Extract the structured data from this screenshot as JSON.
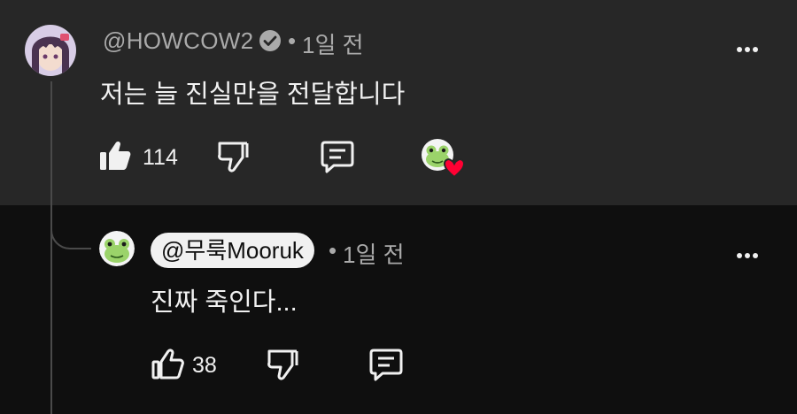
{
  "comment": {
    "author": "@HOWCOW2",
    "verified_icon": "check-circle-icon",
    "separator": "•",
    "time": "1일 전",
    "text": "저는 늘 진실만을 전달합니다",
    "like_count": "114",
    "creator_heart": "creator-heart-icon"
  },
  "reply": {
    "author": "@무룩Mooruk",
    "separator": "•",
    "time": "1일 전",
    "text": "진짜 죽인다...",
    "like_count": "38"
  },
  "colors": {
    "top_bg": "#272727",
    "bottom_bg": "#0f0f0f",
    "muted_text": "#aaaaaa",
    "primary_text": "#f1f1f1",
    "heart": "#ff0033"
  }
}
